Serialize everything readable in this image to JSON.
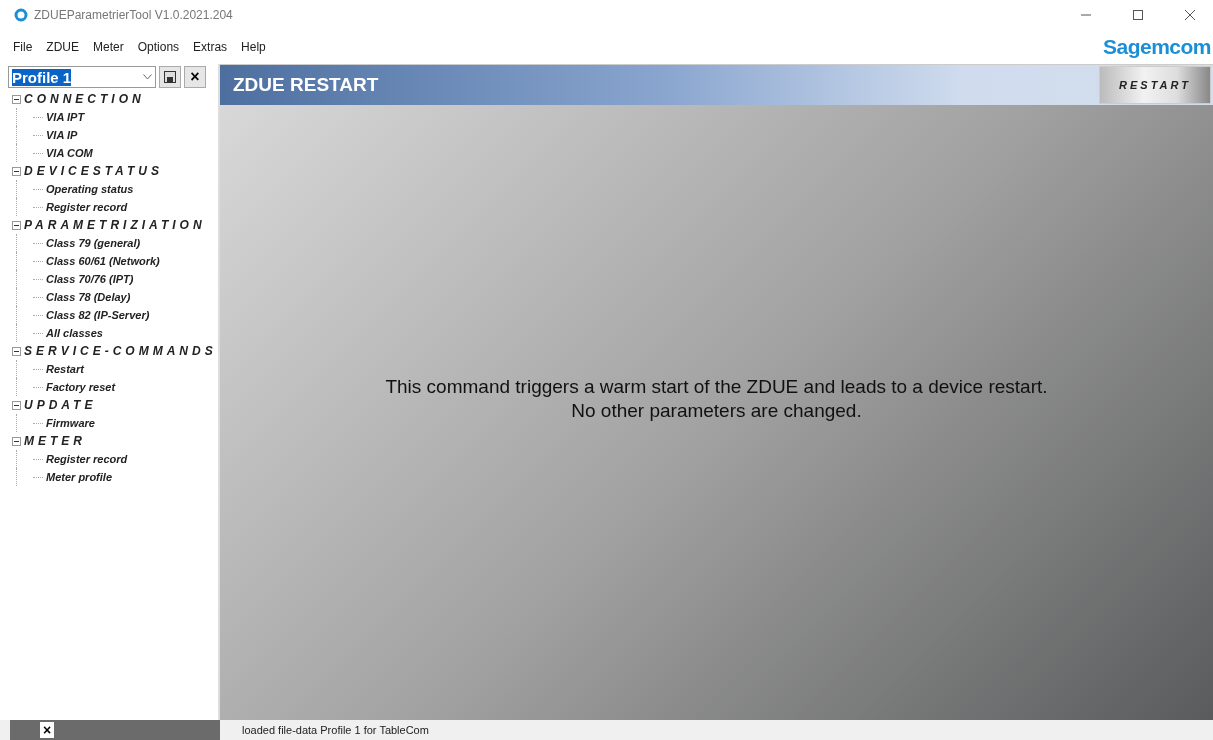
{
  "window": {
    "title": "ZDUEParametrierTool V1.0.2021.204"
  },
  "menu": [
    "File",
    "ZDUE",
    "Meter",
    "Options",
    "Extras",
    "Help"
  ],
  "brand": "Sagemcom",
  "profile": {
    "value": "Profile 1",
    "close_label": "×"
  },
  "tree": [
    {
      "label": "CONNECTION",
      "expanded": true,
      "children": [
        {
          "label": "VIA IPT"
        },
        {
          "label": "VIA IP"
        },
        {
          "label": "VIA COM"
        }
      ]
    },
    {
      "label": "DEVICESTATUS",
      "expanded": true,
      "children": [
        {
          "label": "Operating status"
        },
        {
          "label": "Register record"
        }
      ]
    },
    {
      "label": "PARAMETRIZIATION",
      "expanded": true,
      "children": [
        {
          "label": "Class 79 (general)"
        },
        {
          "label": "Class 60/61 (Network)"
        },
        {
          "label": "Class 70/76 (IPT)"
        },
        {
          "label": "Class 78 (Delay)"
        },
        {
          "label": "Class 82 (IP-Server)"
        },
        {
          "label": "All classes"
        }
      ]
    },
    {
      "label": "SERVICE-COMMANDS",
      "expanded": true,
      "children": [
        {
          "label": "Restart"
        },
        {
          "label": "Factory reset"
        }
      ]
    },
    {
      "label": "UPDATE",
      "expanded": true,
      "children": [
        {
          "label": "Firmware"
        }
      ]
    },
    {
      "label": "METER",
      "expanded": true,
      "children": [
        {
          "label": "Register record"
        },
        {
          "label": "Meter profile"
        }
      ]
    }
  ],
  "header": {
    "title": "ZDUE RESTART",
    "button": "RESTART"
  },
  "message": [
    "This command triggers a warm start of the ZDUE and leads to a device restart.",
    "No other parameters are changed."
  ],
  "status_bar": {
    "close_label": "×",
    "text": "loaded file-data Profile 1 for TableCom"
  }
}
